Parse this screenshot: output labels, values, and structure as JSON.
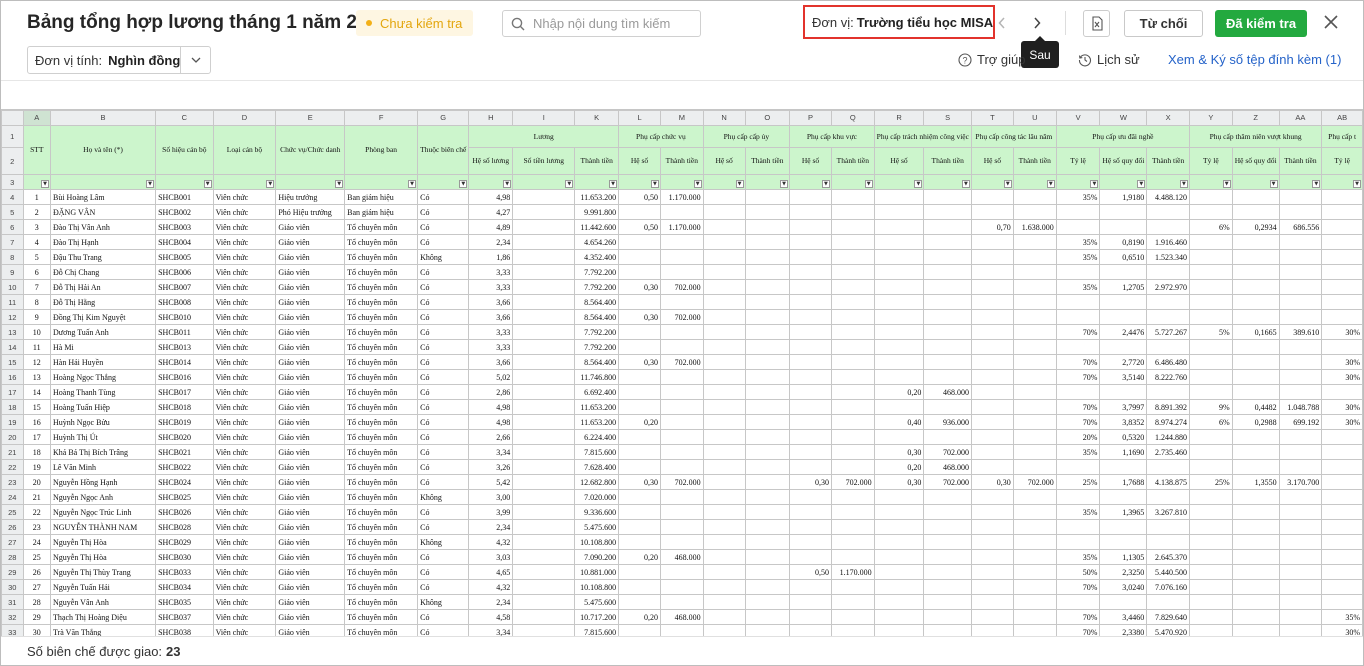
{
  "header": {
    "title": "Bảng tổng hợp lương tháng 1 năm 2024",
    "status": "Chưa kiểm tra",
    "search_placeholder": "Nhập nội dung tìm kiếm",
    "unit_label": "Đơn vị:",
    "unit_value": "Trường tiểu học MISA",
    "tooltip_next": "Sau",
    "reject_label": "Từ chối",
    "approve_label": "Đã kiểm tra",
    "colors": {
      "approve": "#23a93f",
      "status_text": "#e3a60e",
      "status_bg": "#fef6e2",
      "highlight_border": "#e2332c",
      "link": "#2563c9"
    }
  },
  "toolbar": {
    "unit_calc_label": "Đơn vị tính:",
    "unit_calc_value": "Nghìn đồng",
    "help_label": "Trợ giúp",
    "history_label": "Lịch sử",
    "attach_label": "Xem & Ký số tệp đính kèm (1)"
  },
  "sheet": {
    "col_letters": [
      "A",
      "B",
      "C",
      "D",
      "E",
      "F",
      "G",
      "H",
      "I",
      "K",
      "L",
      "M",
      "N",
      "O",
      "P",
      "Q",
      "R",
      "S",
      "T",
      "U",
      "V",
      "W",
      "X",
      "Y",
      "Z",
      "AA",
      "AB"
    ],
    "row_headers": [
      "1",
      "2",
      "3"
    ],
    "headers": {
      "stt": "STT",
      "name": "Họ và tên (*)",
      "code": "Số hiệu cán bộ",
      "type": "Loại cán bộ",
      "position": "Chức vụ/Chức danh",
      "dept": "Phòng ban",
      "bienche": "Thuộc biên chế",
      "luong": "Lương",
      "pc_chucvu": "Phụ cấp chức vụ",
      "pc_capuy": "Phụ cấp cấp ủy",
      "pc_khuvuc": "Phụ cấp khu vực",
      "pc_trachnhiem": "Phụ cấp trách nhiệm công việc",
      "pc_congtac": "Phụ cấp công tác lâu năm",
      "pc_uudai": "Phụ cấp ưu đãi nghề",
      "pc_thamnien": "Phụ cấp thâm niên vượt khung",
      "pc_cut": "Phụ cấp t",
      "heso_luong": "Hệ số lương",
      "sotien_luong": "Số tiền lương",
      "thanh_tien": "Thành tiền",
      "he_so": "Hệ số",
      "ty_le": "Tỷ lệ",
      "heso_quydoi": "Hệ số quy đổi"
    },
    "rows": [
      {
        "r": "4",
        "c": [
          "1",
          "Bùi Hoàng Lâm",
          "SHCB001",
          "Viên chức",
          "Hiệu trưởng",
          "Ban giám hiệu",
          "Có",
          "4,98",
          "",
          "11.653.200",
          "0,50",
          "1.170.000",
          "",
          "",
          "",
          "",
          "",
          "",
          "",
          "",
          "35%",
          "1,9180",
          "4.488.120",
          "",
          "",
          "",
          ""
        ]
      },
      {
        "r": "5",
        "c": [
          "2",
          "ĐẶNG VÂN",
          "SHCB002",
          "Viên chức",
          "Phó Hiệu trưởng",
          "Ban giám hiệu",
          "Có",
          "4,27",
          "",
          "9.991.800",
          "",
          "",
          "",
          "",
          "",
          "",
          "",
          "",
          "",
          "",
          "",
          "",
          "",
          "",
          "",
          "",
          ""
        ]
      },
      {
        "r": "6",
        "c": [
          "3",
          "Đào Thị Vân Anh",
          "SHCB003",
          "Viên chức",
          "Giáo viên",
          "Tổ chuyên môn",
          "Có",
          "4,89",
          "",
          "11.442.600",
          "0,50",
          "1.170.000",
          "",
          "",
          "",
          "",
          "",
          "",
          "0,70",
          "1.638.000",
          "",
          "",
          "",
          "6%",
          "0,2934",
          "686.556",
          ""
        ]
      },
      {
        "r": "7",
        "c": [
          "4",
          "Đào Thị Hạnh",
          "SHCB004",
          "Viên chức",
          "Giáo viên",
          "Tổ chuyên môn",
          "Có",
          "2,34",
          "",
          "4.654.260",
          "",
          "",
          "",
          "",
          "",
          "",
          "",
          "",
          "",
          "",
          "35%",
          "0,8190",
          "1.916.460",
          "",
          "",
          "",
          ""
        ]
      },
      {
        "r": "8",
        "c": [
          "5",
          "Đậu Thu Trang",
          "SHCB005",
          "Viên chức",
          "Giáo viên",
          "Tổ chuyên môn",
          "Không",
          "1,86",
          "",
          "4.352.400",
          "",
          "",
          "",
          "",
          "",
          "",
          "",
          "",
          "",
          "",
          "35%",
          "0,6510",
          "1.523.340",
          "",
          "",
          "",
          ""
        ]
      },
      {
        "r": "9",
        "c": [
          "6",
          "Đỗ Chị Chang",
          "SHCB006",
          "Viên chức",
          "Giáo viên",
          "Tổ chuyên môn",
          "Có",
          "3,33",
          "",
          "7.792.200",
          "",
          "",
          "",
          "",
          "",
          "",
          "",
          "",
          "",
          "",
          "",
          "",
          "",
          "",
          "",
          "",
          ""
        ]
      },
      {
        "r": "10",
        "c": [
          "7",
          "Đỗ Thị Hải An",
          "SHCB007",
          "Viên chức",
          "Giáo viên",
          "Tổ chuyên môn",
          "Có",
          "3,33",
          "",
          "7.792.200",
          "0,30",
          "702.000",
          "",
          "",
          "",
          "",
          "",
          "",
          "",
          "",
          "35%",
          "1,2705",
          "2.972.970",
          "",
          "",
          "",
          ""
        ]
      },
      {
        "r": "11",
        "c": [
          "8",
          "Đỗ Thị Hằng",
          "SHCB008",
          "Viên chức",
          "Giáo viên",
          "Tổ chuyên môn",
          "Có",
          "3,66",
          "",
          "8.564.400",
          "",
          "",
          "",
          "",
          "",
          "",
          "",
          "",
          "",
          "",
          "",
          "",
          "",
          "",
          "",
          "",
          ""
        ]
      },
      {
        "r": "12",
        "c": [
          "9",
          "Đồng Thị Kim Nguyệt",
          "SHCB010",
          "Viên chức",
          "Giáo viên",
          "Tổ chuyên môn",
          "Có",
          "3,66",
          "",
          "8.564.400",
          "0,30",
          "702.000",
          "",
          "",
          "",
          "",
          "",
          "",
          "",
          "",
          "",
          "",
          "",
          "",
          "",
          "",
          ""
        ]
      },
      {
        "r": "13",
        "c": [
          "10",
          "Dương Tuấn Anh",
          "SHCB011",
          "Viên chức",
          "Giáo viên",
          "Tổ chuyên môn",
          "Có",
          "3,33",
          "",
          "7.792.200",
          "",
          "",
          "",
          "",
          "",
          "",
          "",
          "",
          "",
          "",
          "70%",
          "2,4476",
          "5.727.267",
          "5%",
          "0,1665",
          "389.610",
          "30%"
        ]
      },
      {
        "r": "14",
        "c": [
          "11",
          "Hà Mi",
          "SHCB013",
          "Viên chức",
          "Giáo viên",
          "Tổ chuyên môn",
          "Có",
          "3,33",
          "",
          "7.792.200",
          "",
          "",
          "",
          "",
          "",
          "",
          "",
          "",
          "",
          "",
          "",
          "",
          "",
          "",
          "",
          "",
          ""
        ]
      },
      {
        "r": "15",
        "c": [
          "12",
          "Hàn Hải Huyền",
          "SHCB014",
          "Viên chức",
          "Giáo viên",
          "Tổ chuyên môn",
          "Có",
          "3,66",
          "",
          "8.564.400",
          "0,30",
          "702.000",
          "",
          "",
          "",
          "",
          "",
          "",
          "",
          "",
          "70%",
          "2,7720",
          "6.486.480",
          "",
          "",
          "",
          "30%"
        ]
      },
      {
        "r": "16",
        "c": [
          "13",
          "Hoàng Ngọc Thắng",
          "SHCB016",
          "Viên chức",
          "Giáo viên",
          "Tổ chuyên môn",
          "Có",
          "5,02",
          "",
          "11.746.800",
          "",
          "",
          "",
          "",
          "",
          "",
          "",
          "",
          "",
          "",
          "70%",
          "3,5140",
          "8.222.760",
          "",
          "",
          "",
          "30%"
        ]
      },
      {
        "r": "17",
        "c": [
          "14",
          "Hoàng Thanh Tùng",
          "SHCB017",
          "Viên chức",
          "Giáo viên",
          "Tổ chuyên môn",
          "Có",
          "2,86",
          "",
          "6.692.400",
          "",
          "",
          "",
          "",
          "",
          "",
          "0,20",
          "468.000",
          "",
          "",
          "",
          "",
          "",
          "",
          "",
          "",
          ""
        ]
      },
      {
        "r": "18",
        "c": [
          "15",
          "Hoàng Tuấn Hiệp",
          "SHCB018",
          "Viên chức",
          "Giáo viên",
          "Tổ chuyên môn",
          "Có",
          "4,98",
          "",
          "11.653.200",
          "",
          "",
          "",
          "",
          "",
          "",
          "",
          "",
          "",
          "",
          "70%",
          "3,7997",
          "8.891.392",
          "9%",
          "0,4482",
          "1.048.788",
          "30%"
        ]
      },
      {
        "r": "19",
        "c": [
          "16",
          "Huỳnh Ngọc Bửu",
          "SHCB019",
          "Viên chức",
          "Giáo viên",
          "Tổ chuyên môn",
          "Có",
          "4,98",
          "",
          "11.653.200",
          "0,20",
          "",
          "",
          "",
          "",
          "",
          "0,40",
          "936.000",
          "",
          "",
          "70%",
          "3,8352",
          "8.974.274",
          "6%",
          "0,2988",
          "699.192",
          "30%"
        ]
      },
      {
        "r": "20",
        "c": [
          "17",
          "Huỳnh Thị Út",
          "SHCB020",
          "Viên chức",
          "Giáo viên",
          "Tổ chuyên môn",
          "Có",
          "2,66",
          "",
          "6.224.400",
          "",
          "",
          "",
          "",
          "",
          "",
          "",
          "",
          "",
          "",
          "20%",
          "0,5320",
          "1.244.880",
          "",
          "",
          "",
          ""
        ]
      },
      {
        "r": "21",
        "c": [
          "18",
          "Khả Bá Thị Bích Trâng",
          "SHCB021",
          "Viên chức",
          "Giáo viên",
          "Tổ chuyên môn",
          "Có",
          "3,34",
          "",
          "7.815.600",
          "",
          "",
          "",
          "",
          "",
          "",
          "0,30",
          "702.000",
          "",
          "",
          "35%",
          "1,1690",
          "2.735.460",
          "",
          "",
          "",
          ""
        ]
      },
      {
        "r": "22",
        "c": [
          "19",
          "Lê Văn Minh",
          "SHCB022",
          "Viên chức",
          "Giáo viên",
          "Tổ chuyên môn",
          "Có",
          "3,26",
          "",
          "7.628.400",
          "",
          "",
          "",
          "",
          "",
          "",
          "0,20",
          "468.000",
          "",
          "",
          "",
          "",
          "",
          "",
          "",
          "",
          ""
        ]
      },
      {
        "r": "23",
        "c": [
          "20",
          "Nguyễn Hồng Hạnh",
          "SHCB024",
          "Viên chức",
          "Giáo viên",
          "Tổ chuyên môn",
          "Có",
          "5,42",
          "",
          "12.682.800",
          "0,30",
          "702.000",
          "",
          "",
          "0,30",
          "702.000",
          "0,30",
          "702.000",
          "0,30",
          "702.000",
          "25%",
          "1,7688",
          "4.138.875",
          "25%",
          "1,3550",
          "3.170.700",
          ""
        ]
      },
      {
        "r": "24",
        "c": [
          "21",
          "Nguyễn Ngọc Anh",
          "SHCB025",
          "Viên chức",
          "Giáo viên",
          "Tổ chuyên môn",
          "Không",
          "3,00",
          "",
          "7.020.000",
          "",
          "",
          "",
          "",
          "",
          "",
          "",
          "",
          "",
          "",
          "",
          "",
          "",
          "",
          "",
          "",
          ""
        ]
      },
      {
        "r": "25",
        "c": [
          "22",
          "Nguyễn Ngọc Trúc Linh",
          "SHCB026",
          "Viên chức",
          "Giáo viên",
          "Tổ chuyên môn",
          "Có",
          "3,99",
          "",
          "9.336.600",
          "",
          "",
          "",
          "",
          "",
          "",
          "",
          "",
          "",
          "",
          "35%",
          "1,3965",
          "3.267.810",
          "",
          "",
          "",
          ""
        ]
      },
      {
        "r": "26",
        "c": [
          "23",
          "NGUYỄN THÀNH NAM",
          "SHCB028",
          "Viên chức",
          "Giáo viên",
          "Tổ chuyên môn",
          "Có",
          "2,34",
          "",
          "5.475.600",
          "",
          "",
          "",
          "",
          "",
          "",
          "",
          "",
          "",
          "",
          "",
          "",
          "",
          "",
          "",
          "",
          ""
        ]
      },
      {
        "r": "27",
        "c": [
          "24",
          "Nguyễn Thị Hòa",
          "SHCB029",
          "Viên chức",
          "Giáo viên",
          "Tổ chuyên môn",
          "Không",
          "4,32",
          "",
          "10.108.800",
          "",
          "",
          "",
          "",
          "",
          "",
          "",
          "",
          "",
          "",
          "",
          "",
          "",
          "",
          "",
          "",
          ""
        ]
      },
      {
        "r": "28",
        "c": [
          "25",
          "Nguyễn Thị Hòa",
          "SHCB030",
          "Viên chức",
          "Giáo viên",
          "Tổ chuyên môn",
          "Có",
          "3,03",
          "",
          "7.090.200",
          "0,20",
          "468.000",
          "",
          "",
          "",
          "",
          "",
          "",
          "",
          "",
          "35%",
          "1,1305",
          "2.645.370",
          "",
          "",
          "",
          ""
        ]
      },
      {
        "r": "29",
        "c": [
          "26",
          "Nguyễn Thị Thùy Trang",
          "SHCB033",
          "Viên chức",
          "Giáo viên",
          "Tổ chuyên môn",
          "Có",
          "4,65",
          "",
          "10.881.000",
          "",
          "",
          "",
          "",
          "0,50",
          "1.170.000",
          "",
          "",
          "",
          "",
          "50%",
          "2,3250",
          "5.440.500",
          "",
          "",
          "",
          ""
        ]
      },
      {
        "r": "30",
        "c": [
          "27",
          "Nguyễn Tuấn Hải",
          "SHCB034",
          "Viên chức",
          "Giáo viên",
          "Tổ chuyên môn",
          "Có",
          "4,32",
          "",
          "10.108.800",
          "",
          "",
          "",
          "",
          "",
          "",
          "",
          "",
          "",
          "",
          "70%",
          "3,0240",
          "7.076.160",
          "",
          "",
          "",
          ""
        ]
      },
      {
        "r": "31",
        "c": [
          "28",
          "Nguyễn Vân Anh",
          "SHCB035",
          "Viên chức",
          "Giáo viên",
          "Tổ chuyên môn",
          "Không",
          "2,34",
          "",
          "5.475.600",
          "",
          "",
          "",
          "",
          "",
          "",
          "",
          "",
          "",
          "",
          "",
          "",
          "",
          "",
          "",
          "",
          ""
        ]
      },
      {
        "r": "32",
        "c": [
          "29",
          "Thạch Thị Hoàng Diệu",
          "SHCB037",
          "Viên chức",
          "Giáo viên",
          "Tổ chuyên môn",
          "Có",
          "4,58",
          "",
          "10.717.200",
          "0,20",
          "468.000",
          "",
          "",
          "",
          "",
          "",
          "",
          "",
          "",
          "70%",
          "3,4460",
          "7.829.640",
          "",
          "",
          "",
          "35%"
        ]
      },
      {
        "r": "33",
        "c": [
          "30",
          "Trà Văn Thắng",
          "SHCB038",
          "Viên chức",
          "Giáo viên",
          "Tổ chuyên môn",
          "Có",
          "3,34",
          "",
          "7.815.600",
          "",
          "",
          "",
          "",
          "",
          "",
          "",
          "",
          "",
          "",
          "70%",
          "2,3380",
          "5.470.920",
          "",
          "",
          "",
          "30%"
        ]
      }
    ]
  },
  "footer": {
    "label": "Số biên chế được giao:",
    "value": "23"
  }
}
